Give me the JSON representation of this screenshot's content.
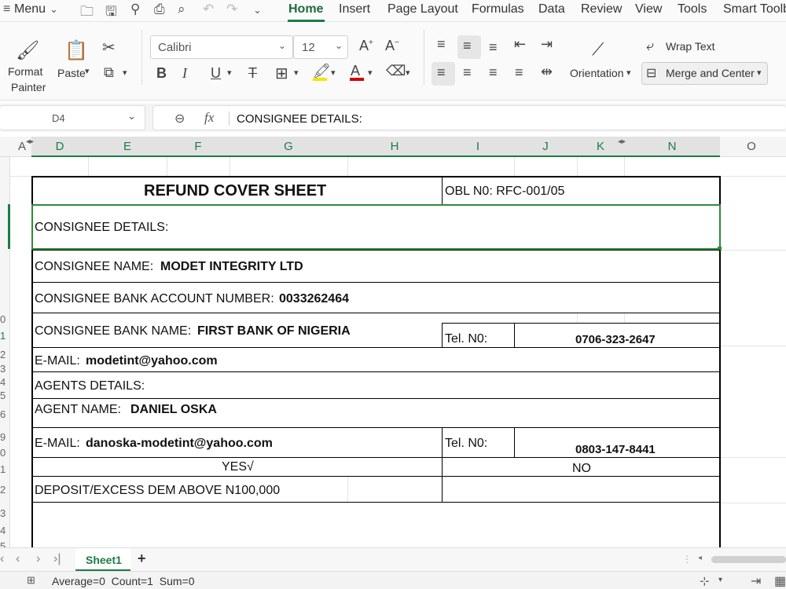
{
  "menu": {
    "menu_label": "Menu",
    "tabs": [
      "Home",
      "Insert",
      "Page Layout",
      "Formulas",
      "Data",
      "Review",
      "View",
      "Tools",
      "Smart Toolb"
    ]
  },
  "ribbon": {
    "format_painter": "Format Painter",
    "format_painter_l1": "Format",
    "format_painter_l2": "Painter",
    "paste": "Paste",
    "font_name": "Calibri",
    "font_size": "12",
    "wrap_text": "Wrap Text",
    "orientation": "Orientation",
    "merge_center": "Merge and Center"
  },
  "formula_bar": {
    "cell_ref": "D4",
    "fx": "fx",
    "content": "CONSIGNEE DETAILS:"
  },
  "columns": [
    "A",
    "D",
    "E",
    "F",
    "G",
    "H",
    "I",
    "J",
    "K",
    "N",
    "O"
  ],
  "rows": [
    "0",
    "1",
    "2",
    "3",
    "4",
    "5",
    "6",
    "9",
    "0",
    "1",
    "2",
    "3",
    "4",
    "5"
  ],
  "sheet": {
    "title": "REFUND COVER SHEET",
    "obl": "OBL N0: RFC-001/05",
    "consignee_details": "CONSIGNEE DETAILS:",
    "consignee_name_label": "CONSIGNEE NAME:",
    "consignee_name": "MODET INTEGRITY LTD",
    "account_label": "CONSIGNEE BANK ACCOUNT NUMBER:",
    "account": "0033262464",
    "bank_label": "CONSIGNEE BANK NAME:",
    "bank": "FIRST BANK OF NIGERIA",
    "tel_label": "Tel. N0:",
    "tel1": "0706-323-2647",
    "email_label": "E-MAIL:",
    "email1": "modetint@yahoo.com",
    "agents_details": "AGENTS DETAILS:",
    "agent_name_label": "AGENT NAME:",
    "agent_name": "DANIEL OSKA",
    "email2": "danoska-modetint@yahoo.com",
    "tel2": "0803-147-8441",
    "yes": "YES√",
    "no": "NO",
    "deposit": "DEPOSIT/EXCESS DEM ABOVE N100,000"
  },
  "tabs": {
    "sheet1": "Sheet1",
    "add": "+"
  },
  "status": {
    "summary": "Average=0  Count=1  Sum=0"
  },
  "colors": {
    "accent": "#1e7b45",
    "selection": "#2e8b3a"
  }
}
